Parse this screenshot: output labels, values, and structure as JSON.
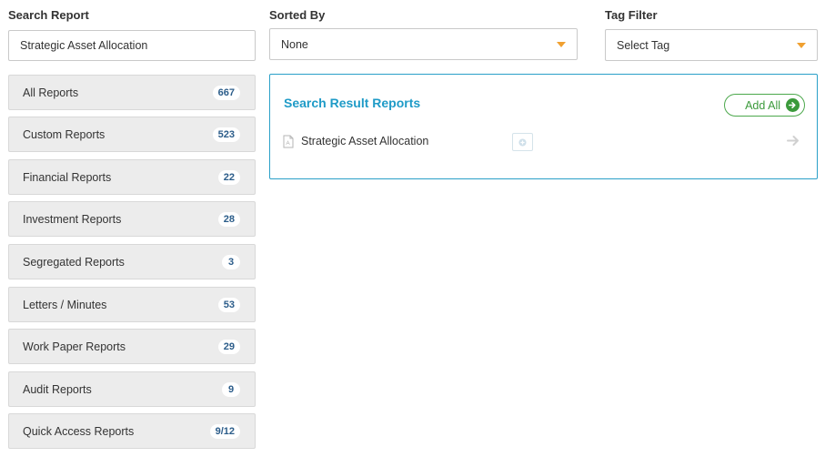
{
  "filters": {
    "search_label": "Search Report",
    "search_value": "Strategic Asset Allocation",
    "sorted_label": "Sorted By",
    "sorted_value": "None",
    "tag_label": "Tag Filter",
    "tag_value": "Select Tag"
  },
  "sidebar": {
    "items": [
      {
        "label": "All Reports",
        "count": "667"
      },
      {
        "label": "Custom Reports",
        "count": "523"
      },
      {
        "label": "Financial Reports",
        "count": "22"
      },
      {
        "label": "Investment Reports",
        "count": "28"
      },
      {
        "label": "Segregated Reports",
        "count": "3"
      },
      {
        "label": "Letters / Minutes",
        "count": "53"
      },
      {
        "label": "Work Paper Reports",
        "count": "29"
      },
      {
        "label": "Audit Reports",
        "count": "9"
      },
      {
        "label": "Quick Access Reports",
        "count": "9/12"
      }
    ]
  },
  "results": {
    "title": "Search Result Reports",
    "add_all_label": "Add All",
    "reports": [
      {
        "name": "Strategic Asset Allocation",
        "icon": "pdf-document-icon"
      }
    ]
  },
  "colors": {
    "accent_blue": "#1f9bc7",
    "accent_green": "#3b9a3b",
    "caret_orange": "#f0a030",
    "badge_text": "#2c5d8a"
  }
}
